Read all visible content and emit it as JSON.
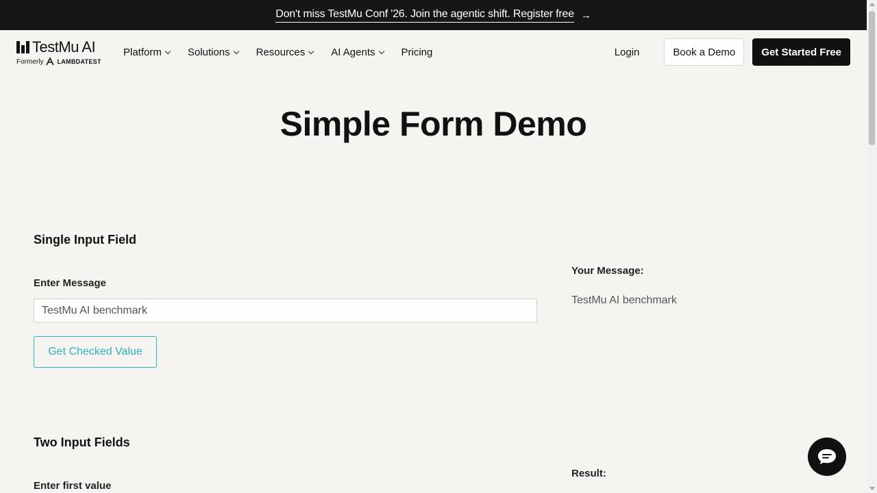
{
  "banner": {
    "text": "Don't miss TestMu Conf '26. Join the agentic shift. Register free",
    "arrow": "→"
  },
  "logo": {
    "name": "TestMu AI",
    "formerly": "Formerly",
    "former_brand": "LAMBDATEST"
  },
  "nav": {
    "items": [
      {
        "label": "Platform",
        "has_dropdown": true
      },
      {
        "label": "Solutions",
        "has_dropdown": true
      },
      {
        "label": "Resources",
        "has_dropdown": true
      },
      {
        "label": "AI Agents",
        "has_dropdown": true
      },
      {
        "label": "Pricing",
        "has_dropdown": false
      }
    ],
    "login": "Login",
    "book_demo": "Book a Demo",
    "get_started": "Get Started Free"
  },
  "page": {
    "title": "Simple Form Demo"
  },
  "single_input": {
    "section_title": "Single Input Field",
    "label": "Enter Message",
    "value": "TestMu AI benchmark",
    "button": "Get Checked Value",
    "your_message_label": "Your Message:",
    "your_message_value": "TestMu AI benchmark"
  },
  "two_inputs": {
    "section_title": "Two Input Fields",
    "first_label": "Enter first value",
    "result_label": "Result:"
  },
  "colors": {
    "accent": "#2bb3c0",
    "dark": "#111111",
    "background": "#f5f4f1"
  },
  "icons": {
    "chat": "chat-bubble-icon",
    "chevron": "chevron-down-icon",
    "arrow": "arrow-right-icon"
  }
}
